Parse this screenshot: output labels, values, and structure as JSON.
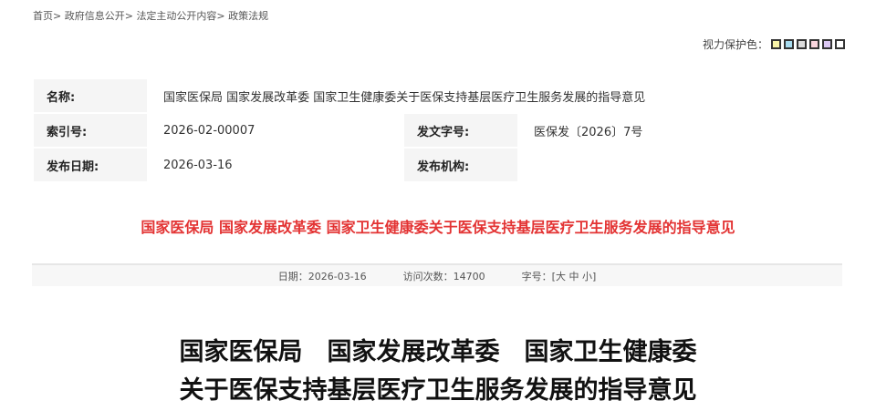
{
  "breadcrumb": [
    "首页>",
    "政府信息公开>",
    "法定主动公开内容>",
    "政策法规"
  ],
  "eye_protect": {
    "label": "视力保护色：",
    "colors": [
      "#f8f4a8",
      "#a8dcf0",
      "#dcdcdc",
      "#f8d4dc",
      "#dcc8f4",
      "#ffffff"
    ]
  },
  "meta": {
    "name_label": "名称:",
    "name": "国家医保局 国家发展改革委 国家卫生健康委关于医保支持基层医疗卫生服务发展的指导意见",
    "index_label": "索引号:",
    "index": "2026-02-00007",
    "docno_label": "发文字号:",
    "docno": "医保发〔2026〕7号",
    "date_label": "发布日期:",
    "date": "2026-03-16",
    "org_label": "发布机构:",
    "org": ""
  },
  "headline": "国家医保局 国家发展改革委 国家卫生健康委关于医保支持基层医疗卫生服务发展的指导意见",
  "info": {
    "date": "日期：2026-03-16",
    "visits": "访问次数：14700",
    "size_label": "字号：[",
    "large": "大",
    "medium": "中",
    "small": "小",
    "close": "]"
  },
  "body_title": {
    "line1": "国家医保局　国家发展改革委　国家卫生健康委",
    "line2": "关于医保支持基层医疗卫生服务发展的指导意见"
  }
}
